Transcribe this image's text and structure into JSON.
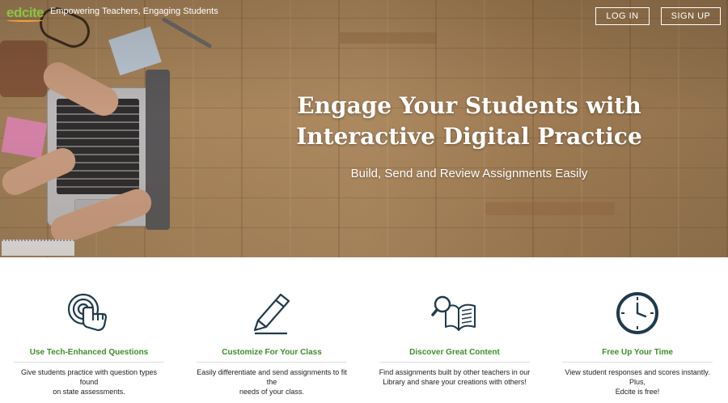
{
  "header": {
    "logo_text": "edcite",
    "tagline": "Empowering Teachers, Engaging Students",
    "login_label": "LOG IN",
    "signup_label": "SIGN UP"
  },
  "hero": {
    "headline_line1": "Engage Your Students with",
    "headline_line2": "Interactive Digital Practice",
    "subheadline": "Build, Send and Review Assignments Easily"
  },
  "features": [
    {
      "icon": "touch-hand-icon",
      "title": "Use Tech-Enhanced Questions",
      "desc_line1": "Give students practice with question types found",
      "desc_line2": "on state assessments."
    },
    {
      "icon": "pencil-icon",
      "title": "Customize For Your Class",
      "desc_line1": "Easily differentiate and send assignments to fit the",
      "desc_line2": "needs of your class."
    },
    {
      "icon": "magnifier-book-icon",
      "title": "Discover Great Content",
      "desc_line1": "Find assignments built by other teachers in our",
      "desc_line2": "Library and share your creations with others!"
    },
    {
      "icon": "clock-icon",
      "title": "Free Up Your Time",
      "desc_line1": "View student responses and scores instantly. Plus,",
      "desc_line2": "Edcite is free!"
    }
  ],
  "colors": {
    "accent_green": "#3f8d2a",
    "logo_green": "#8ac43f",
    "logo_orange": "#f2a23a",
    "icon_navy": "#1f3a4d"
  }
}
